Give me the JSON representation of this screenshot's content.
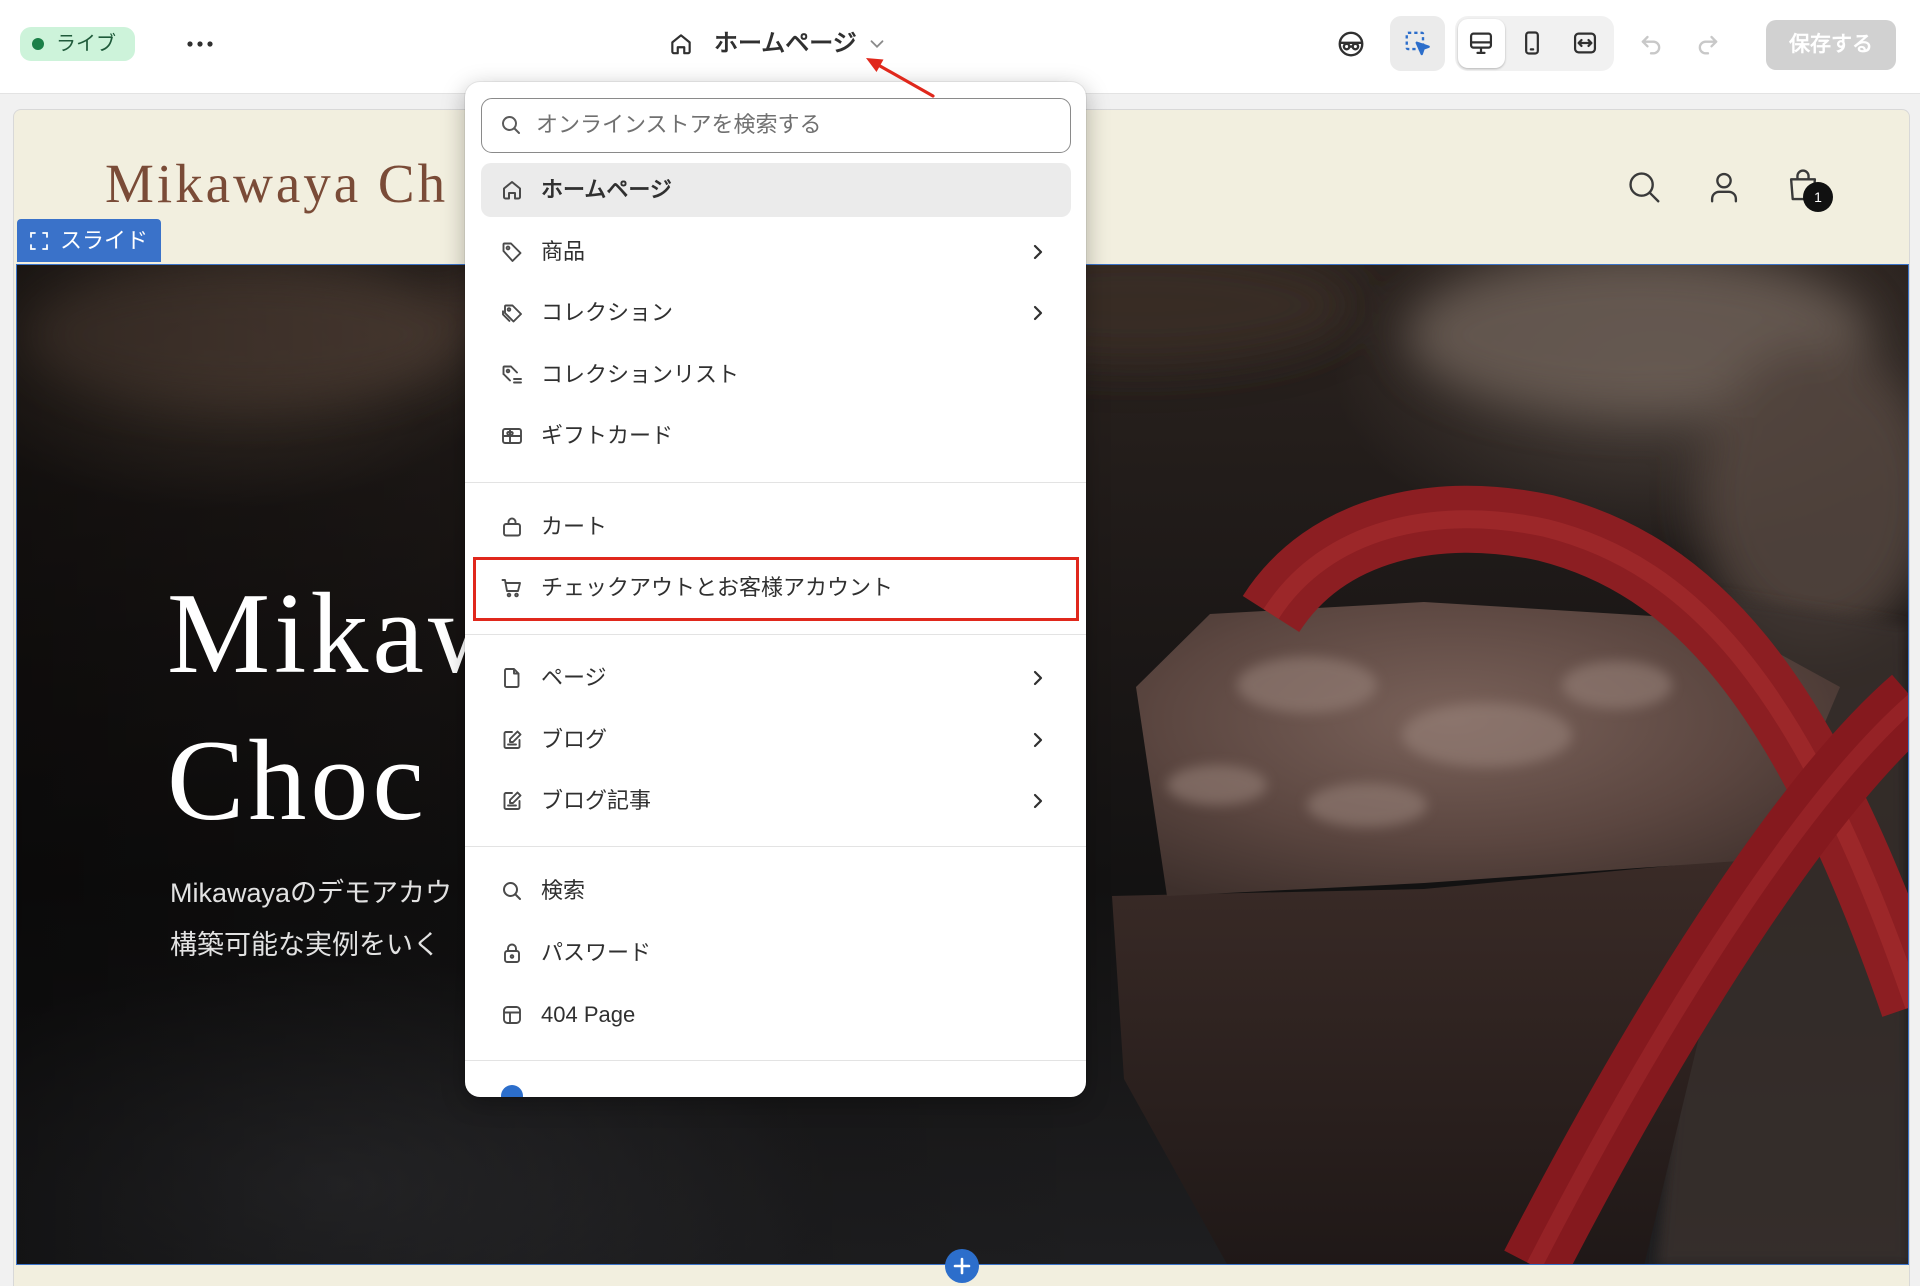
{
  "topbar": {
    "status": "ライブ",
    "page_selector": "ホームページ",
    "save": "保存する",
    "icons": [
      "more-horizontal-icon",
      "home-icon",
      "chevron-down-icon",
      "incognito-icon",
      "inspector-icon",
      "desktop-icon",
      "mobile-icon",
      "fullwidth-icon",
      "undo-icon",
      "redo-icon"
    ]
  },
  "store": {
    "name": "Mikawaya Ch",
    "cart_count": "1",
    "icons": [
      "search-icon",
      "account-icon",
      "bag-icon"
    ]
  },
  "section": {
    "label": "スライド"
  },
  "hero": {
    "title_lines": [
      "Mikaw",
      "Choc"
    ],
    "text_lines": [
      "Mikawayaのデモアカウ",
      "構築可能な実例をいく"
    ]
  },
  "menu": {
    "search_placeholder": "オンラインストアを検索する",
    "items": [
      {
        "label": "ホームページ",
        "icon": "home-icon",
        "selected": true
      },
      {
        "label": "商品",
        "icon": "product-tag-icon",
        "submenu": true
      },
      {
        "label": "コレクション",
        "icon": "collection-icon",
        "submenu": true
      },
      {
        "label": "コレクションリスト",
        "icon": "collection-list-icon"
      },
      {
        "label": "ギフトカード",
        "icon": "gift-card-icon"
      },
      {
        "label": "カート",
        "icon": "bag-icon"
      },
      {
        "label": "チェックアウトとお客様アカウント",
        "icon": "checkout-cart-icon",
        "highlighted": true
      },
      {
        "label": "ページ",
        "icon": "page-icon",
        "submenu": true
      },
      {
        "label": "ブログ",
        "icon": "blog-icon",
        "submenu": true
      },
      {
        "label": "ブログ記事",
        "icon": "blog-post-icon",
        "submenu": true
      },
      {
        "label": "検索",
        "icon": "search-icon"
      },
      {
        "label": "パスワード",
        "icon": "lock-icon"
      },
      {
        "label": "404 Page",
        "icon": "layout-icon"
      }
    ]
  },
  "colors": {
    "accent_blue": "#2c6ecb",
    "annotation_red": "#e0281c",
    "live_green": "#1b7f48",
    "store_background": "#f2efdf",
    "store_brand": "#7a4b37",
    "ribbon_red": "#8c1e22"
  }
}
